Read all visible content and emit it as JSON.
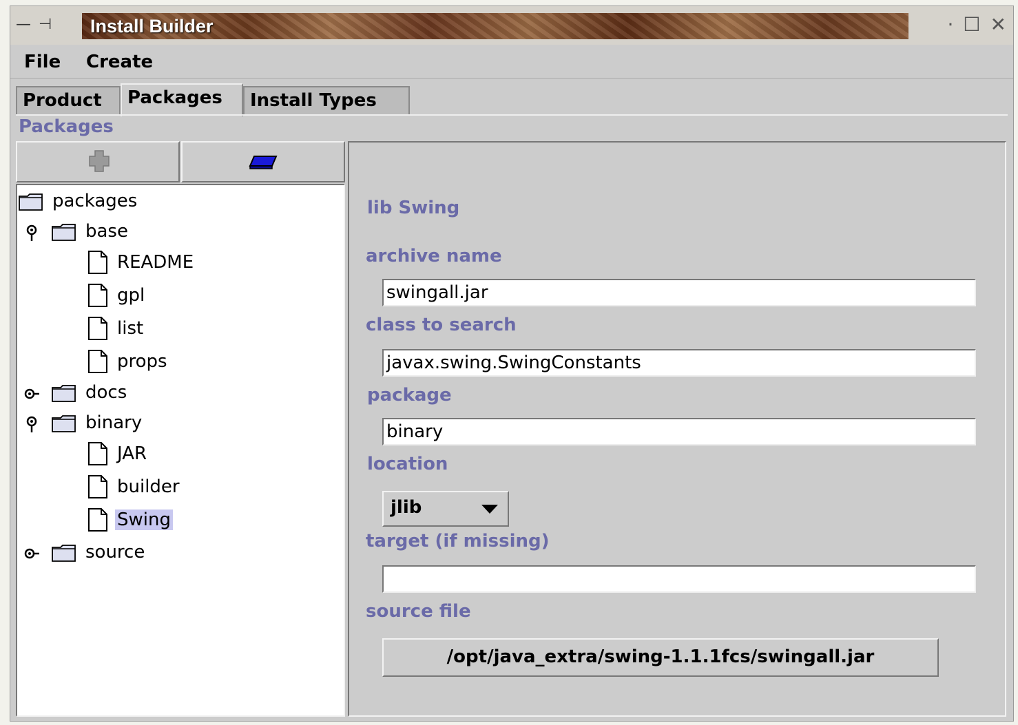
{
  "window": {
    "title": "Install Builder",
    "controls": {
      "left": "— ⊣",
      "right_dot": "·",
      "maximize": "☐",
      "close": "✕"
    }
  },
  "menu": {
    "file": "File",
    "create": "Create"
  },
  "tabs": [
    {
      "label": "Product",
      "active": false
    },
    {
      "label": "Packages",
      "active": true
    },
    {
      "label": "Install Types",
      "active": false
    }
  ],
  "section_title": "Packages",
  "toolbar": {
    "add_icon": "puzzle-add-icon",
    "remove_icon": "eraser-icon"
  },
  "tree": {
    "root": "packages",
    "nodes": [
      {
        "label": "base",
        "type": "folder",
        "expanded": true
      },
      {
        "label": "README",
        "type": "file"
      },
      {
        "label": "gpl",
        "type": "file"
      },
      {
        "label": "list",
        "type": "file"
      },
      {
        "label": "props",
        "type": "file"
      },
      {
        "label": "docs",
        "type": "folder",
        "expanded": false
      },
      {
        "label": "binary",
        "type": "folder",
        "expanded": true
      },
      {
        "label": "JAR",
        "type": "file"
      },
      {
        "label": "builder",
        "type": "file"
      },
      {
        "label": "Swing",
        "type": "file",
        "selected": true
      },
      {
        "label": "source",
        "type": "folder",
        "expanded": false
      }
    ]
  },
  "detail": {
    "heading": "lib Swing",
    "archive_name": {
      "label": "archive name",
      "value": "swingall.jar"
    },
    "class_to_search": {
      "label": "class to search",
      "value": "javax.swing.SwingConstants"
    },
    "package": {
      "label": "package",
      "value": "binary"
    },
    "location": {
      "label": "location",
      "value": "jlib"
    },
    "target": {
      "label": "target (if missing)",
      "value": ""
    },
    "source_file": {
      "label": "source file",
      "value": "/opt/java_extra/swing-1.1.1fcs/swingall.jar"
    }
  },
  "colors": {
    "label_accent": "#6a6aa8",
    "selection": "#c8c8f0",
    "panel": "#cccccc"
  }
}
